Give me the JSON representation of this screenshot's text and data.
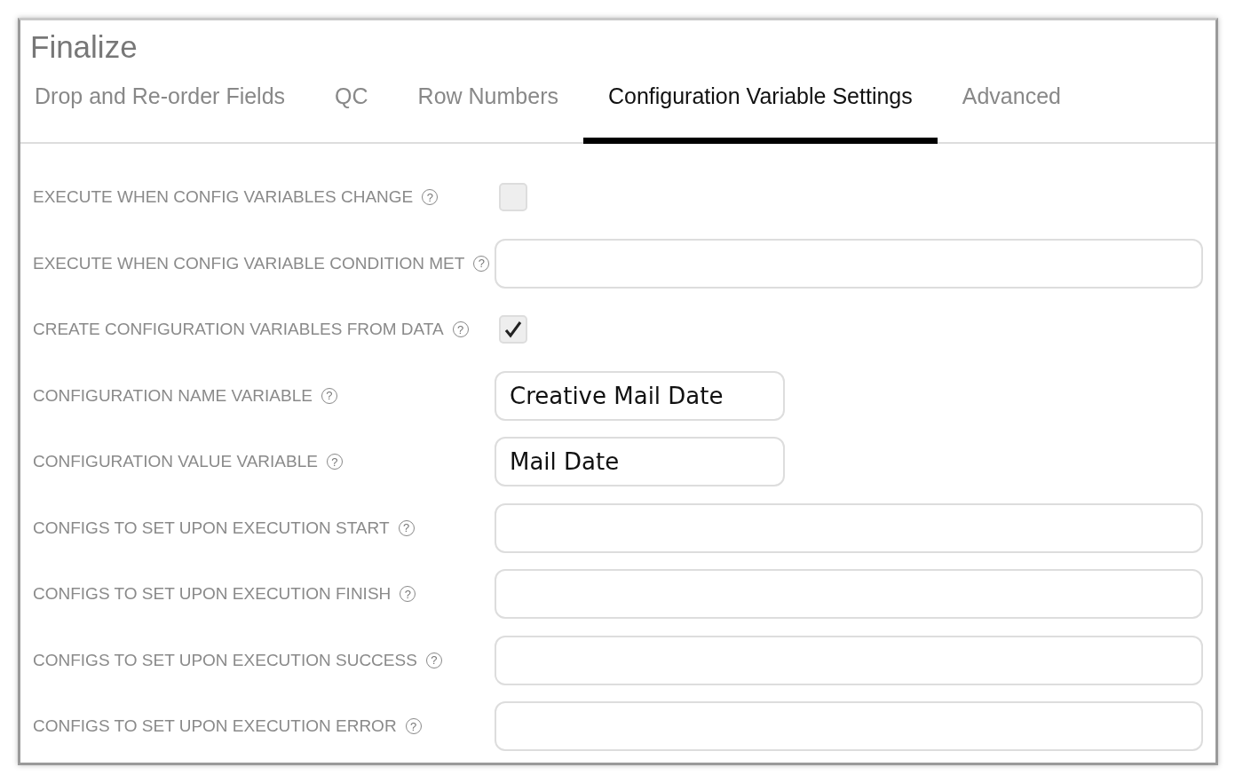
{
  "title": "Finalize",
  "tabs": [
    {
      "label": "Drop and Re-order Fields",
      "selected": false
    },
    {
      "label": "QC",
      "selected": false
    },
    {
      "label": "Row Numbers",
      "selected": false
    },
    {
      "label": "Configuration Variable Settings",
      "selected": true
    },
    {
      "label": "Advanced",
      "selected": false
    }
  ],
  "fields": [
    {
      "label": "EXECUTE WHEN CONFIG VARIABLES CHANGE",
      "help": "?",
      "kind": "checkbox",
      "checked": false
    },
    {
      "label": "EXECUTE WHEN CONFIG VARIABLE CONDITION MET",
      "help": "?",
      "kind": "text_wide"
    },
    {
      "label": "CREATE CONFIGURATION VARIABLES FROM DATA",
      "help": "?",
      "kind": "checkbox",
      "checked": true
    },
    {
      "label": "CONFIGURATION NAME VARIABLE",
      "help": "?",
      "kind": "text_short",
      "value": "Creative Mail Date"
    },
    {
      "label": "CONFIGURATION VALUE VARIABLE",
      "help": "?",
      "kind": "text_short",
      "value": "Mail Date"
    },
    {
      "label": "CONFIGS TO SET UPON EXECUTION START",
      "help": "?",
      "kind": "text_wide"
    },
    {
      "label": "CONFIGS TO SET UPON EXECUTION FINISH",
      "help": "?",
      "kind": "text_wide"
    },
    {
      "label": "CONFIGS TO SET UPON EXECUTION SUCCESS",
      "help": "?",
      "kind": "text_wide"
    },
    {
      "label": "CONFIGS TO SET UPON EXECUTION ERROR",
      "help": "?",
      "kind": "text_wide"
    }
  ]
}
